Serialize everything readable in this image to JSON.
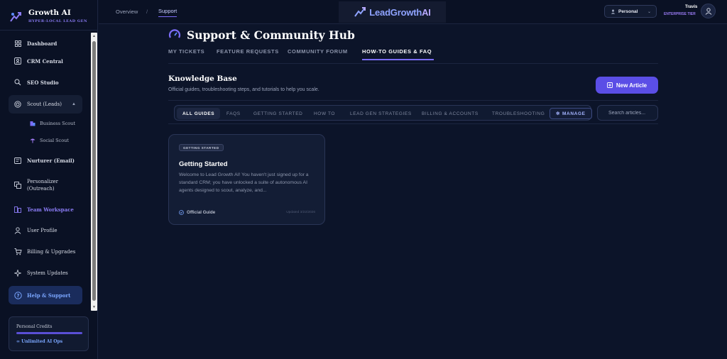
{
  "brand": {
    "name": "Growth AI",
    "tagline": "HYPER-LOCAL LEAD GEN"
  },
  "sidebar": {
    "items": [
      {
        "label": "Dashboard",
        "icon": "grid-icon"
      },
      {
        "label": "CRM Central",
        "icon": "contact-card-icon"
      },
      {
        "label": "SEO Studio",
        "icon": "magnifier-icon"
      },
      {
        "label": "Scout (Leads)",
        "icon": "target-icon",
        "expanded": true
      },
      {
        "label": "Business Scout",
        "icon": "building-icon"
      },
      {
        "label": "Social Scout",
        "icon": "megaphone-icon"
      },
      {
        "label": "Nurturer (Email)",
        "icon": "mail-icon"
      },
      {
        "label": "Personalizer (Outreach)",
        "icon": "copy-icon"
      },
      {
        "label": "Team Workspace",
        "icon": "team-icon"
      },
      {
        "label": "User Profile",
        "icon": "user-icon"
      },
      {
        "label": "Billing & Upgrades",
        "icon": "cart-icon"
      },
      {
        "label": "System Updates",
        "icon": "sparkle-icon"
      },
      {
        "label": "Help & Support",
        "icon": "help-icon",
        "active": true
      }
    ],
    "credits": {
      "title": "Personal Credits",
      "value": "∞ Unlimited AI Ops"
    }
  },
  "header": {
    "breadcrumb": [
      "Overview",
      "Support"
    ],
    "separator": "/",
    "banner": {
      "part1": "LeadGrowth",
      "part2": "AI"
    },
    "persona": "Personal",
    "user": {
      "name": "Travis",
      "tier": "ENTERPRISE TIER"
    }
  },
  "page": {
    "title": "Support & Community Hub",
    "tabs": [
      "MY TICKETS",
      "FEATURE REQUESTS",
      "COMMUNITY FORUM",
      "HOW-TO GUIDES & FAQ"
    ],
    "active_tab": "HOW-TO GUIDES & FAQ",
    "kb_title": "Knowledge Base",
    "kb_subtitle": "Official guides, troubleshooting steps, and tutorials to help you scale.",
    "new_article": "New Article",
    "filters": [
      "ALL GUIDES",
      "FAQS",
      "GETTING STARTED",
      "HOW TO",
      "LEAD GEN STRATEGIES",
      "BILLING & ACCOUNTS",
      "TROUBLESHOOTING"
    ],
    "active_filter": "ALL GUIDES",
    "manage": "MANAGE",
    "search_placeholder": "Search articles..."
  },
  "articles": [
    {
      "badge": "GETTING STARTED",
      "title": "Getting Started",
      "excerpt": "Welcome to Lead Growth AI! You haven't just signed up for a standard CRM; you have unlocked a suite of autonomous AI agents designed to scout, analyze, and...",
      "footer": "Official Guide",
      "updated": "Updated 3/22/2026"
    }
  ],
  "colors": {
    "accent": "#5b4ee6",
    "active_nav": "#1a2c5c",
    "background": "#0c1429"
  }
}
